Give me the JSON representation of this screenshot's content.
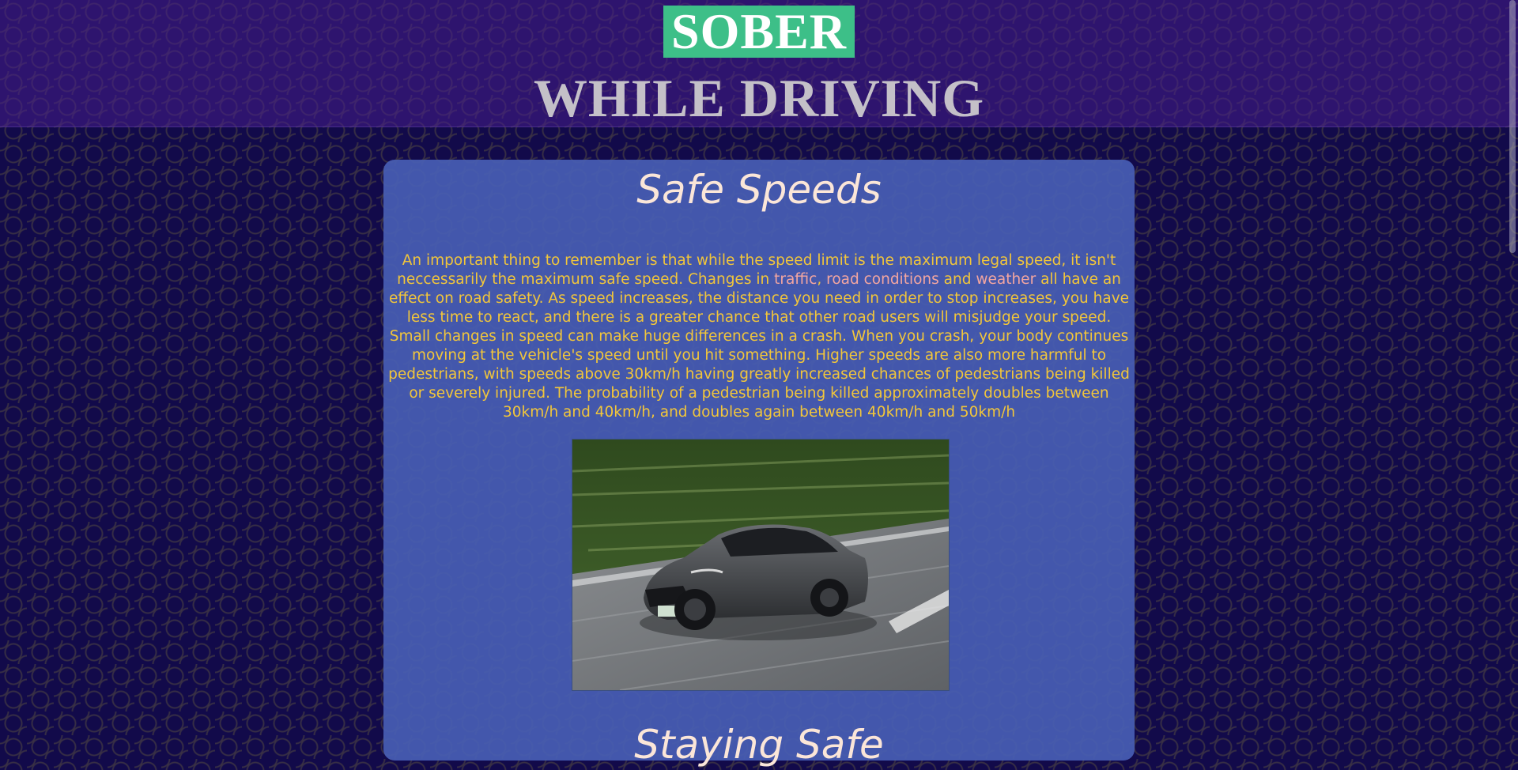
{
  "header": {
    "badge_text": "SOBER",
    "title": "WHILE DRIVING"
  },
  "section": {
    "title": "Safe Speeds",
    "body": {
      "part1": "An important thing to remember is that while the speed limit is the maximum legal speed, it isn't neccessarily the maximum safe speed. Changes in ",
      "link1": "traffic",
      "sep1": ", ",
      "link2": "road conditions",
      "sep2": " and ",
      "link3": "weather",
      "part2": " all have an effect on road safety. As speed increases, the distance you need in order to stop increases, you have less time to react, and there is a greater chance that other road users will misjudge your speed. Small changes in speed can make huge differences in a crash. When you crash, your body continues moving at the vehicle's speed until you hit something. Higher speeds are also more harmful to pedestrians, with speeds above 30km/h having greatly increased chances of pedestrians being killed or severely injured. The probability of a pedestrian being killed approximately doubles between 30km/h and 40km/h, and doubles again between 40km/h and 50km/h"
    },
    "image_subject": "grey-sports-coupe-driving-on-road"
  },
  "next_section": {
    "title": "Staying Safe"
  },
  "colors": {
    "background": "#120a4a",
    "header_band": "#3c1e7a",
    "badge": "#3dbf88",
    "card": "#485eb4",
    "body_text": "#f2c63a",
    "highlight_text": "#f4a6a0",
    "title_text": "#fbe6d8"
  }
}
